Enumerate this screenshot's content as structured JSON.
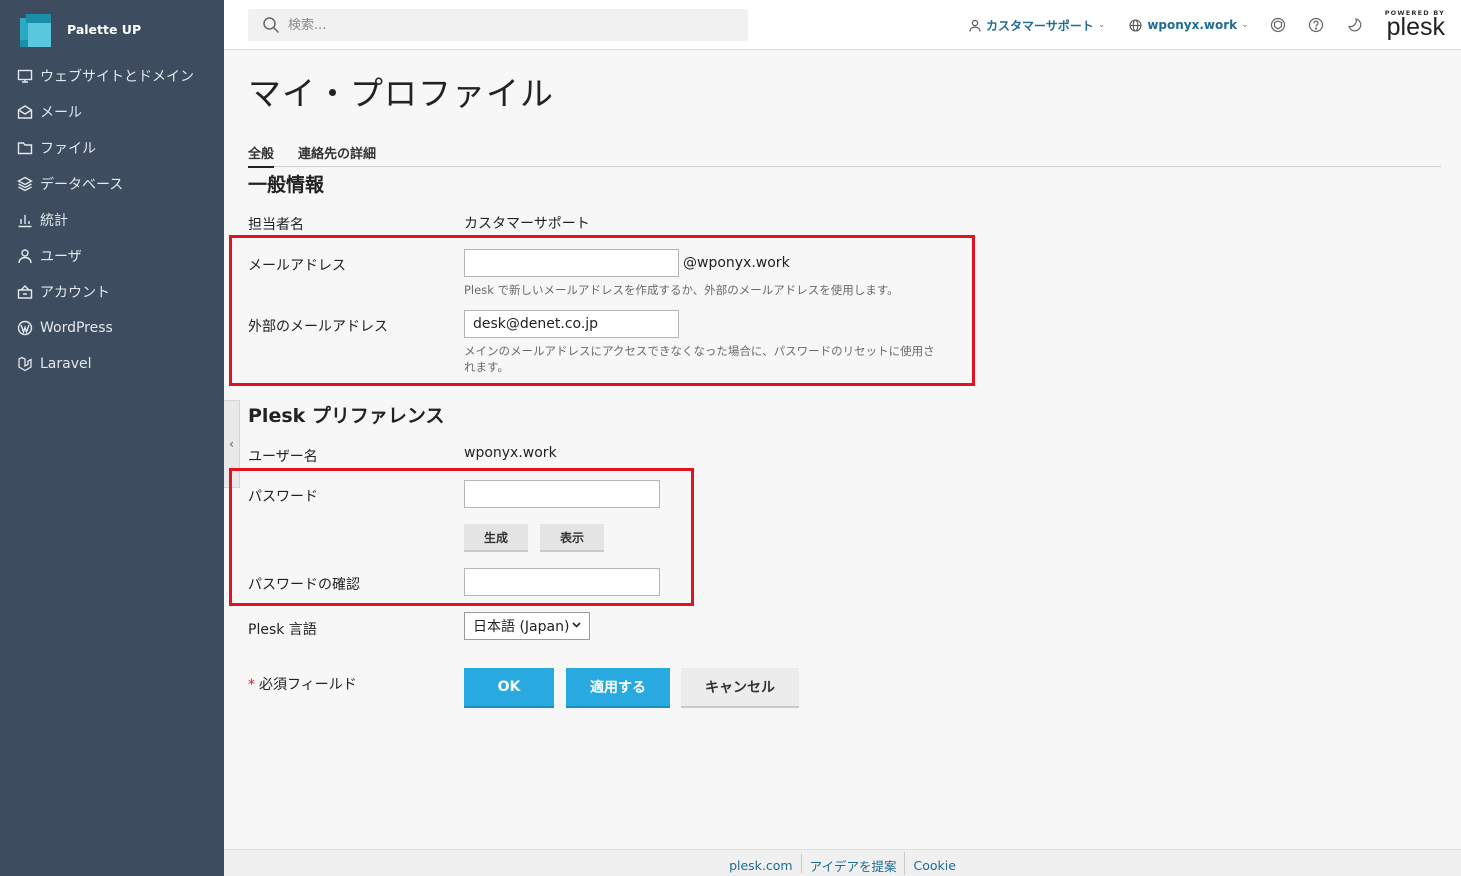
{
  "brand": {
    "name": "Palette UP"
  },
  "sidebar": {
    "items": [
      {
        "label": "ウェブサイトとドメイン",
        "icon": "monitor-icon"
      },
      {
        "label": "メール",
        "icon": "mail-icon"
      },
      {
        "label": "ファイル",
        "icon": "folder-icon"
      },
      {
        "label": "データベース",
        "icon": "database-icon"
      },
      {
        "label": "統計",
        "icon": "stats-icon"
      },
      {
        "label": "ユーザ",
        "icon": "user-icon"
      },
      {
        "label": "アカウント",
        "icon": "account-icon"
      },
      {
        "label": "WordPress",
        "icon": "wordpress-icon"
      },
      {
        "label": "Laravel",
        "icon": "laravel-icon"
      }
    ]
  },
  "topbar": {
    "search_placeholder": "検索...",
    "user_label": "カスタマーサポート",
    "domain_label": "wponyx.work",
    "powered_by": "POWERED BY",
    "plesk": "plesk"
  },
  "page": {
    "title": "マイ・プロファイル",
    "tabs": [
      "全般",
      "連絡先の詳細"
    ]
  },
  "general": {
    "title": "一般情報",
    "contact_label": "担当者名",
    "contact_value": "カスタマーサポート",
    "email_label": "メールアドレス",
    "email_value": "",
    "email_domain": "@wponyx.work",
    "email_hint": "Plesk で新しいメールアドレスを作成するか、外部のメールアドレスを使用します。",
    "ext_email_label": "外部のメールアドレス",
    "ext_email_value": "desk@denet.co.jp",
    "ext_email_hint_1": "メインのメールアドレスにアクセスできなくなった場合に、パスワードのリセットに使用さ",
    "ext_email_hint_2": "れます。"
  },
  "prefs": {
    "title": "Plesk プリファレンス",
    "username_label": "ユーザー名",
    "username_value": "wponyx.work",
    "password_label": "パスワード",
    "generate_label": "生成",
    "show_label": "表示",
    "confirm_label": "パスワードの確認",
    "language_label": "Plesk 言語",
    "language_value": "日本語 (Japan)"
  },
  "form": {
    "required_star": "*",
    "required_text": "必須フィールド",
    "ok": "OK",
    "apply": "適用する",
    "cancel": "キャンセル"
  },
  "footer": {
    "links": [
      "plesk.com",
      "アイデアを提案",
      "Cookie"
    ]
  },
  "colors": {
    "sidebar_bg": "#3d4c5e",
    "primary": "#28aae1",
    "highlight": "#e0141e",
    "link": "#1e6b93"
  }
}
